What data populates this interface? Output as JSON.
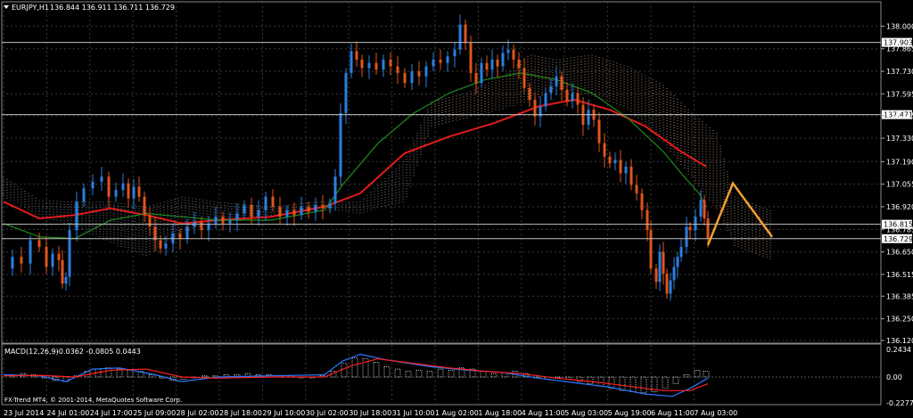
{
  "chart_data": [
    {
      "type": "candlestick",
      "header": {
        "symbol": "EURJPY,H1",
        "ohlc": "136.844 136.911 136.711 136.729"
      },
      "y_ticks": [
        "138.000",
        "137.865",
        "137.730",
        "137.595",
        "137.465",
        "137.330",
        "137.190",
        "137.055",
        "136.920",
        "136.785",
        "136.650",
        "136.515",
        "136.385",
        "136.250",
        "136.120"
      ],
      "ylim": [
        136.12,
        138.05
      ],
      "price_levels": [
        {
          "label": "137.903",
          "value": 137.903,
          "color": "#000000"
        },
        {
          "label": "137.471",
          "value": 137.471,
          "color": "#000000"
        },
        {
          "label": "136.815",
          "value": 136.815,
          "color": "#000000"
        },
        {
          "label": "136.729",
          "value": 136.729,
          "color": "#000000"
        }
      ],
      "x_labels": [
        "23 Jul 2014",
        "24 Jul 01:00",
        "24 Jul 17:00",
        "25 Jul 09:00",
        "28 Jul 02:00",
        "28 Jul 18:00",
        "29 Jul 10:00",
        "30 Jul 02:00",
        "30 Jul 18:00",
        "31 Jul 10:00",
        "1 Aug 02:00",
        "1 Aug 18:00",
        "4 Aug 11:00",
        "5 Aug 03:00",
        "5 Aug 19:00",
        "6 Aug 11:00",
        "7 Aug 03:00"
      ],
      "close_path": [
        [
          0,
          136.55
        ],
        [
          10,
          136.62
        ],
        [
          20,
          136.58
        ],
        [
          30,
          136.72
        ],
        [
          40,
          136.68
        ],
        [
          48,
          136.56
        ],
        [
          55,
          136.64
        ],
        [
          62,
          136.6
        ],
        [
          66,
          136.46
        ],
        [
          70,
          136.5
        ],
        [
          74,
          136.78
        ],
        [
          82,
          136.95
        ],
        [
          90,
          137.03
        ],
        [
          100,
          137.07
        ],
        [
          110,
          137.1
        ],
        [
          118,
          136.98
        ],
        [
          126,
          137.02
        ],
        [
          134,
          137.06
        ],
        [
          140,
          136.97
        ],
        [
          146,
          137.04
        ],
        [
          152,
          136.98
        ],
        [
          158,
          136.87
        ],
        [
          164,
          136.8
        ],
        [
          170,
          136.72
        ],
        [
          176,
          136.67
        ],
        [
          182,
          136.7
        ],
        [
          190,
          136.76
        ],
        [
          198,
          136.73
        ],
        [
          206,
          136.8
        ],
        [
          214,
          136.83
        ],
        [
          222,
          136.78
        ],
        [
          230,
          136.82
        ],
        [
          238,
          136.86
        ],
        [
          246,
          136.82
        ],
        [
          254,
          136.84
        ],
        [
          262,
          136.88
        ],
        [
          270,
          136.93
        ],
        [
          278,
          136.86
        ],
        [
          286,
          136.9
        ],
        [
          294,
          136.98
        ],
        [
          302,
          136.92
        ],
        [
          310,
          136.86
        ],
        [
          318,
          136.9
        ],
        [
          326,
          136.87
        ],
        [
          334,
          136.92
        ],
        [
          342,
          136.89
        ],
        [
          350,
          136.93
        ],
        [
          358,
          136.91
        ],
        [
          366,
          136.94
        ],
        [
          372,
          137.1
        ],
        [
          378,
          137.48
        ],
        [
          384,
          137.72
        ],
        [
          390,
          137.85
        ],
        [
          396,
          137.8
        ],
        [
          402,
          137.75
        ],
        [
          410,
          137.78
        ],
        [
          418,
          137.74
        ],
        [
          426,
          137.8
        ],
        [
          434,
          137.76
        ],
        [
          442,
          137.72
        ],
        [
          450,
          137.66
        ],
        [
          458,
          137.73
        ],
        [
          466,
          137.7
        ],
        [
          474,
          137.76
        ],
        [
          482,
          137.8
        ],
        [
          490,
          137.78
        ],
        [
          498,
          137.82
        ],
        [
          506,
          137.86
        ],
        [
          512,
          138.01
        ],
        [
          518,
          137.9
        ],
        [
          524,
          137.72
        ],
        [
          530,
          137.66
        ],
        [
          536,
          137.78
        ],
        [
          542,
          137.74
        ],
        [
          548,
          137.8
        ],
        [
          554,
          137.76
        ],
        [
          560,
          137.84
        ],
        [
          566,
          137.86
        ],
        [
          572,
          137.8
        ],
        [
          578,
          137.75
        ],
        [
          584,
          137.63
        ],
        [
          590,
          137.56
        ],
        [
          596,
          137.46
        ],
        [
          602,
          137.52
        ],
        [
          608,
          137.6
        ],
        [
          614,
          137.64
        ],
        [
          620,
          137.7
        ],
        [
          626,
          137.62
        ],
        [
          632,
          137.55
        ],
        [
          638,
          137.6
        ],
        [
          644,
          137.53
        ],
        [
          650,
          137.41
        ],
        [
          656,
          137.5
        ],
        [
          662,
          137.44
        ],
        [
          668,
          137.3
        ],
        [
          674,
          137.22
        ],
        [
          680,
          137.18
        ],
        [
          686,
          137.2
        ],
        [
          692,
          137.12
        ],
        [
          698,
          137.16
        ],
        [
          704,
          137.05
        ],
        [
          710,
          137.0
        ],
        [
          716,
          136.9
        ],
        [
          722,
          136.78
        ],
        [
          726,
          136.55
        ],
        [
          732,
          136.47
        ],
        [
          736,
          136.65
        ],
        [
          740,
          136.52
        ],
        [
          744,
          136.4
        ],
        [
          748,
          136.48
        ],
        [
          752,
          136.56
        ],
        [
          756,
          136.62
        ],
        [
          760,
          136.68
        ],
        [
          766,
          136.8
        ],
        [
          770,
          136.78
        ],
        [
          776,
          136.86
        ],
        [
          782,
          136.96
        ],
        [
          786,
          136.85
        ],
        [
          790,
          136.73
        ]
      ],
      "forecast_zigzag": [
        [
          790,
          136.69
        ],
        [
          818,
          137.06
        ],
        [
          862,
          136.74
        ]
      ],
      "series": [
        {
          "name": "ma_red",
          "color": "#e31b1b",
          "points": [
            [
              0,
              136.95
            ],
            [
              40,
              136.85
            ],
            [
              80,
              136.87
            ],
            [
              120,
              136.91
            ],
            [
              160,
              136.87
            ],
            [
              200,
              136.82
            ],
            [
              240,
              136.84
            ],
            [
              300,
              136.86
            ],
            [
              360,
              136.92
            ],
            [
              400,
              137.0
            ],
            [
              450,
              137.24
            ],
            [
              500,
              137.34
            ],
            [
              550,
              137.42
            ],
            [
              600,
              137.52
            ],
            [
              640,
              137.56
            ],
            [
              680,
              137.5
            ],
            [
              720,
              137.4
            ],
            [
              760,
              137.25
            ],
            [
              788,
              137.16
            ]
          ]
        },
        {
          "name": "ma_green",
          "color": "#1e8c1e",
          "points": [
            [
              0,
              136.82
            ],
            [
              40,
              136.74
            ],
            [
              80,
              136.73
            ],
            [
              120,
              136.84
            ],
            [
              160,
              136.88
            ],
            [
              200,
              136.86
            ],
            [
              240,
              136.84
            ],
            [
              300,
              136.84
            ],
            [
              360,
              136.9
            ],
            [
              380,
              137.05
            ],
            [
              420,
              137.3
            ],
            [
              460,
              137.48
            ],
            [
              500,
              137.6
            ],
            [
              540,
              137.68
            ],
            [
              580,
              137.72
            ],
            [
              620,
              137.68
            ],
            [
              660,
              137.6
            ],
            [
              700,
              137.45
            ],
            [
              740,
              137.25
            ],
            [
              760,
              137.12
            ],
            [
              780,
              137.0
            ],
            [
              788,
              136.92
            ]
          ]
        },
        {
          "name": "ichimoku_cloud_top",
          "color": "#8f7f70",
          "points": [
            [
              0,
              137.1
            ],
            [
              40,
              136.96
            ],
            [
              80,
              136.95
            ],
            [
              120,
              136.95
            ],
            [
              160,
              136.92
            ],
            [
              200,
              136.98
            ],
            [
              240,
              136.95
            ],
            [
              300,
              136.92
            ],
            [
              350,
              136.95
            ],
            [
              400,
              136.95
            ],
            [
              450,
              137.2
            ],
            [
              480,
              137.55
            ],
            [
              520,
              137.6
            ],
            [
              560,
              137.7
            ],
            [
              590,
              137.83
            ],
            [
              620,
              137.8
            ],
            [
              660,
              137.83
            ],
            [
              700,
              137.76
            ],
            [
              740,
              137.65
            ],
            [
              770,
              137.49
            ],
            [
              800,
              137.36
            ],
            [
              820,
              136.98
            ],
            [
              860,
              136.9
            ]
          ]
        },
        {
          "name": "ichimoku_cloud_bottom",
          "color": "#8f7f70",
          "points": [
            [
              0,
              136.98
            ],
            [
              40,
              136.86
            ],
            [
              80,
              136.8
            ],
            [
              120,
              136.7
            ],
            [
              160,
              136.62
            ],
            [
              200,
              136.76
            ],
            [
              240,
              136.84
            ],
            [
              300,
              136.86
            ],
            [
              350,
              136.9
            ],
            [
              400,
              136.88
            ],
            [
              450,
              136.94
            ],
            [
              480,
              137.4
            ],
            [
              520,
              137.45
            ],
            [
              560,
              137.5
            ],
            [
              590,
              137.55
            ],
            [
              620,
              137.62
            ],
            [
              660,
              137.58
            ],
            [
              700,
              137.5
            ],
            [
              740,
              137.3
            ],
            [
              770,
              137.1
            ],
            [
              800,
              136.9
            ],
            [
              820,
              136.68
            ],
            [
              860,
              136.6
            ]
          ]
        }
      ]
    },
    {
      "type": "histogram",
      "header": {
        "indicator": "MACD(12,26,9)",
        "values": "-0.0362 -0.0805 0.0443"
      },
      "y_ticks": [
        "0.2434",
        "0.00",
        "-0.2277"
      ],
      "ylim": [
        -0.2277,
        0.2434
      ],
      "x": [
        10,
        22,
        34,
        46,
        58,
        70,
        82,
        94,
        106,
        118,
        130,
        142,
        154,
        166,
        178,
        190,
        202,
        214,
        226,
        238,
        250,
        262,
        274,
        286,
        298,
        310,
        322,
        334,
        346,
        358,
        370,
        382,
        394,
        406,
        418,
        430,
        442,
        454,
        466,
        478,
        490,
        502,
        514,
        526,
        538,
        550,
        562,
        574,
        586,
        598,
        610,
        622,
        634,
        646,
        658,
        670,
        682,
        694,
        706,
        718,
        730,
        742,
        754,
        766,
        778,
        788
      ],
      "values": [
        0.02,
        0.03,
        0.02,
        0.0,
        -0.03,
        -0.04,
        0.01,
        0.05,
        0.07,
        0.08,
        0.07,
        0.06,
        0.05,
        0.02,
        -0.01,
        -0.03,
        -0.02,
        0.0,
        0.01,
        0.01,
        0.02,
        0.02,
        0.03,
        0.02,
        0.02,
        0.01,
        0.01,
        0.0,
        0.0,
        0.01,
        0.05,
        0.12,
        0.17,
        0.16,
        0.13,
        0.09,
        0.07,
        0.05,
        0.06,
        0.05,
        0.07,
        0.06,
        0.08,
        0.07,
        0.05,
        0.03,
        0.04,
        0.05,
        0.03,
        0.0,
        -0.02,
        0.0,
        -0.02,
        -0.04,
        -0.06,
        -0.08,
        -0.1,
        -0.12,
        -0.13,
        -0.14,
        -0.13,
        -0.1,
        -0.06,
        0.02,
        0.06,
        0.05
      ],
      "series": [
        {
          "name": "macd_blue",
          "color": "#2979ff",
          "points": [
            [
              0,
              0.02
            ],
            [
              40,
              0.01
            ],
            [
              70,
              -0.04
            ],
            [
              100,
              0.07
            ],
            [
              130,
              0.08
            ],
            [
              170,
              0.02
            ],
            [
              200,
              -0.04
            ],
            [
              240,
              0.0
            ],
            [
              300,
              0.01
            ],
            [
              360,
              0.02
            ],
            [
              380,
              0.14
            ],
            [
              400,
              0.2
            ],
            [
              430,
              0.15
            ],
            [
              480,
              0.09
            ],
            [
              520,
              0.06
            ],
            [
              560,
              0.04
            ],
            [
              600,
              -0.01
            ],
            [
              640,
              -0.05
            ],
            [
              680,
              -0.09
            ],
            [
              720,
              -0.15
            ],
            [
              750,
              -0.17
            ],
            [
              770,
              -0.1
            ],
            [
              790,
              -0.01
            ]
          ]
        },
        {
          "name": "signal_red",
          "color": "#ff2020",
          "points": [
            [
              0,
              0.01
            ],
            [
              40,
              0.015
            ],
            [
              80,
              0.0
            ],
            [
              120,
              0.06
            ],
            [
              160,
              0.07
            ],
            [
              200,
              0.0
            ],
            [
              240,
              -0.01
            ],
            [
              300,
              0.0
            ],
            [
              360,
              0.0
            ],
            [
              390,
              0.1
            ],
            [
              420,
              0.16
            ],
            [
              460,
              0.12
            ],
            [
              500,
              0.08
            ],
            [
              540,
              0.05
            ],
            [
              580,
              0.03
            ],
            [
              620,
              -0.01
            ],
            [
              660,
              -0.04
            ],
            [
              700,
              -0.08
            ],
            [
              740,
              -0.12
            ],
            [
              770,
              -0.12
            ],
            [
              790,
              -0.06
            ]
          ]
        }
      ]
    }
  ],
  "footer": {
    "copyright": "FX-Trend MT4, © 2001-2014, MetaQuotes Software Corp."
  },
  "colors": {
    "background": "#000000",
    "grid": "#3a3a3a",
    "bull": "#2a7fe0",
    "bear": "#e0551a",
    "forecast": "#f0a030"
  }
}
